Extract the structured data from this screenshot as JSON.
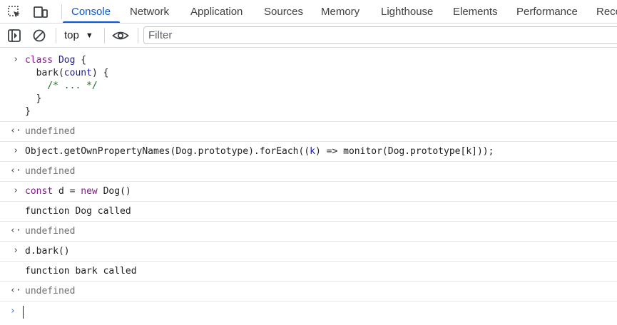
{
  "tabs": [
    {
      "label": "Console",
      "active": true
    },
    {
      "label": "Network"
    },
    {
      "label": "Application"
    },
    {
      "label": "Sources"
    },
    {
      "label": "Memory"
    },
    {
      "label": "Lighthouse"
    },
    {
      "label": "Elements"
    },
    {
      "label": "Performance"
    },
    {
      "label": "Reco"
    }
  ],
  "toolbar": {
    "context": "top",
    "filter_placeholder": "Filter"
  },
  "console": {
    "entry1": {
      "line1a": "class ",
      "line1b": "Dog",
      "line1c": " {",
      "line2a": "  bark(",
      "line2b": "count",
      "line2c": ") {",
      "line3": "    /* ... */",
      "line4": "  }",
      "line5": "}"
    },
    "result1": "undefined",
    "entry2": {
      "a": "Object.getOwnPropertyNames(Dog.prototype).forEach((",
      "b": "k",
      "c": ") => monitor(Dog.prototype[k]));"
    },
    "result2": "undefined",
    "entry3": {
      "a": "const",
      "b": " d = ",
      "c": "new",
      "d": " Dog()"
    },
    "log1": "function Dog called",
    "result3": "undefined",
    "entry4": "d.bark()",
    "log2": "function bark called",
    "result4": "undefined"
  },
  "colors": {
    "accent": "#0b57d0",
    "keyword": "#881391",
    "identifier": "#1a1aa6",
    "comment": "#236e25",
    "muted": "#6e6e6e"
  }
}
